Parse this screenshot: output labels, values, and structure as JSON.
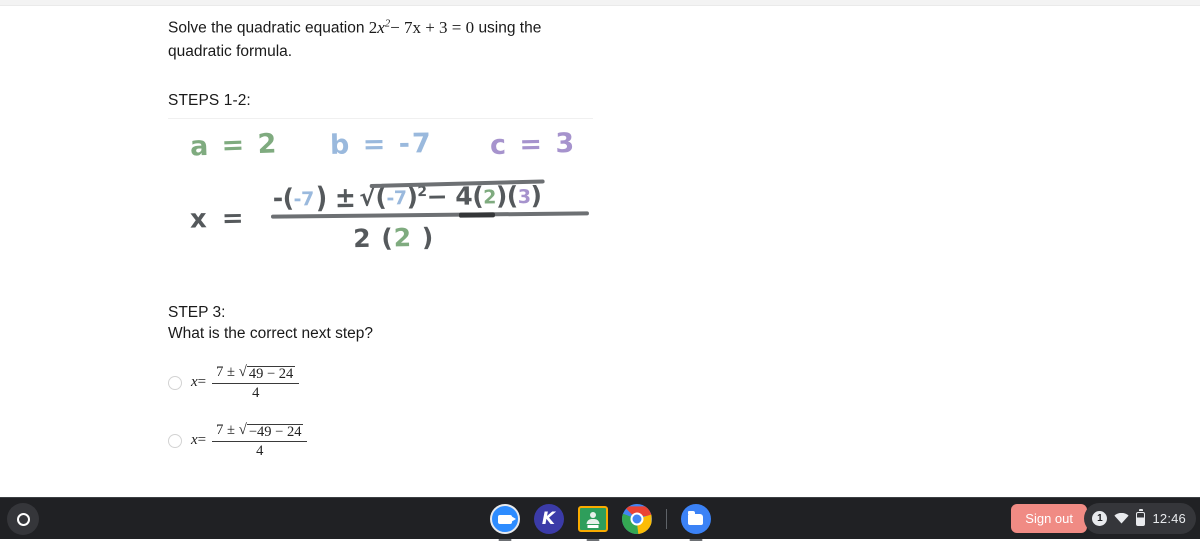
{
  "document": {
    "prompt": {
      "lead": "Solve the quadratic equation",
      "equation_coef_a": "2",
      "equation_var": "x",
      "equation_exp": "2",
      "equation_rest": "− 7x + 3 = 0",
      "trail": "using the quadratic formula."
    },
    "steps_label": "STEPS 1-2:",
    "handwriting": {
      "a_assignment": "a = 2",
      "b_assignment": "b = -7",
      "c_assignment": "c = 3",
      "x_equals": "x =",
      "numerator_lead": "-(",
      "numerator_b": "-7",
      "numerator_mid": ") ±",
      "radicand_b": "-7",
      "radicand_exp": "2",
      "radicand_mid": "− 4(",
      "radicand_a": "2",
      "radicand_c": "3",
      "denominator_lead": "2 (",
      "denominator_a": "2",
      "denominator_close": " )",
      "color_a": "#7fab7f",
      "color_b": "#9ab9dd",
      "color_c": "#a693cd",
      "color_ink": "#55595c"
    },
    "step3": {
      "title": "STEP 3:",
      "question": "What is the correct next step?",
      "options": [
        {
          "lhs": "x",
          "equals": "=",
          "numerator_prefix": "7 ±",
          "radicand": "49 − 24",
          "denominator": "4",
          "selected": false
        },
        {
          "lhs": "x",
          "equals": "=",
          "numerator_prefix": "7 ±",
          "radicand": "−49 − 24",
          "denominator": "4",
          "selected": false
        }
      ]
    }
  },
  "shelf": {
    "launcher_name": "launcher",
    "apps": [
      {
        "id": "zoom",
        "label": "Zoom",
        "running": true,
        "active": false
      },
      {
        "id": "kami",
        "label": "Kami",
        "running": false,
        "active": false
      },
      {
        "id": "classroom",
        "label": "Google Classroom",
        "running": true,
        "active": false
      },
      {
        "id": "chrome",
        "label": "Google Chrome",
        "running": true,
        "active": true
      },
      {
        "id": "files",
        "label": "Files",
        "running": true,
        "active": false
      }
    ],
    "kami_letter": "K",
    "sign_out_label": "Sign out",
    "sign_out_color": "#f08b84",
    "status": {
      "notification_count": "1",
      "wifi": "wifi-full",
      "battery": "battery-60",
      "time": "12:46"
    }
  }
}
